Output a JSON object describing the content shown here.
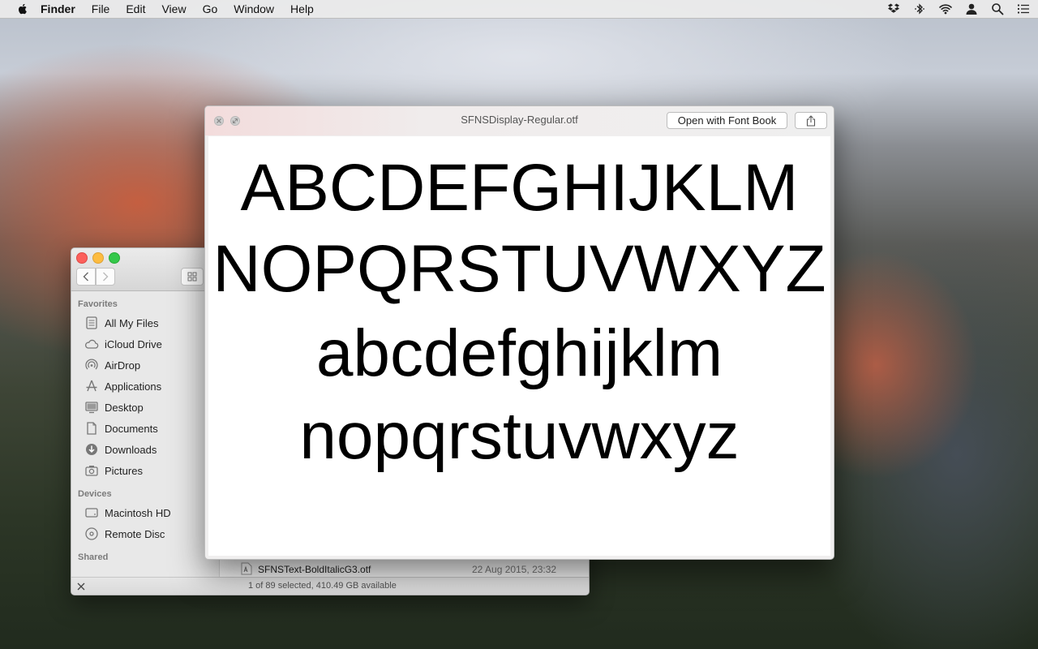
{
  "menubar": {
    "app_name": "Finder",
    "items": [
      "File",
      "Edit",
      "View",
      "Go",
      "Window",
      "Help"
    ],
    "status_icons": [
      "dropbox-icon",
      "bluetooth-icon",
      "wifi-icon",
      "user-icon",
      "spotlight-icon",
      "notification-center-icon"
    ]
  },
  "finder": {
    "sidebar": {
      "favorites_header": "Favorites",
      "favorites": [
        {
          "label": "All My Files",
          "icon": "all-files-icon"
        },
        {
          "label": "iCloud Drive",
          "icon": "cloud-icon"
        },
        {
          "label": "AirDrop",
          "icon": "airdrop-icon"
        },
        {
          "label": "Applications",
          "icon": "applications-icon"
        },
        {
          "label": "Desktop",
          "icon": "desktop-icon"
        },
        {
          "label": "Documents",
          "icon": "documents-icon"
        },
        {
          "label": "Downloads",
          "icon": "downloads-icon"
        },
        {
          "label": "Pictures",
          "icon": "camera-icon"
        }
      ],
      "devices_header": "Devices",
      "devices": [
        {
          "label": "Macintosh HD",
          "icon": "disk-icon"
        },
        {
          "label": "Remote Disc",
          "icon": "remote-disc-icon"
        }
      ],
      "shared_header": "Shared"
    },
    "file_row": {
      "name": "SFNSText-BoldItalicG3.otf",
      "date": "22 Aug 2015, 23:32"
    },
    "status": "1 of 89 selected, 410.49 GB available"
  },
  "quicklook": {
    "title": "SFNSDisplay-Regular.otf",
    "open_button": "Open with Font Book",
    "sample_lines": [
      "ABCDEFGHIJKLM",
      "NOPQRSTUVWXYZ",
      "abcdefghijklm",
      "nopqrstuvwxyz"
    ]
  },
  "colors": {
    "close_red": "#fc605c",
    "minimize_yellow": "#fdbc40",
    "zoom_green": "#34c84a"
  }
}
